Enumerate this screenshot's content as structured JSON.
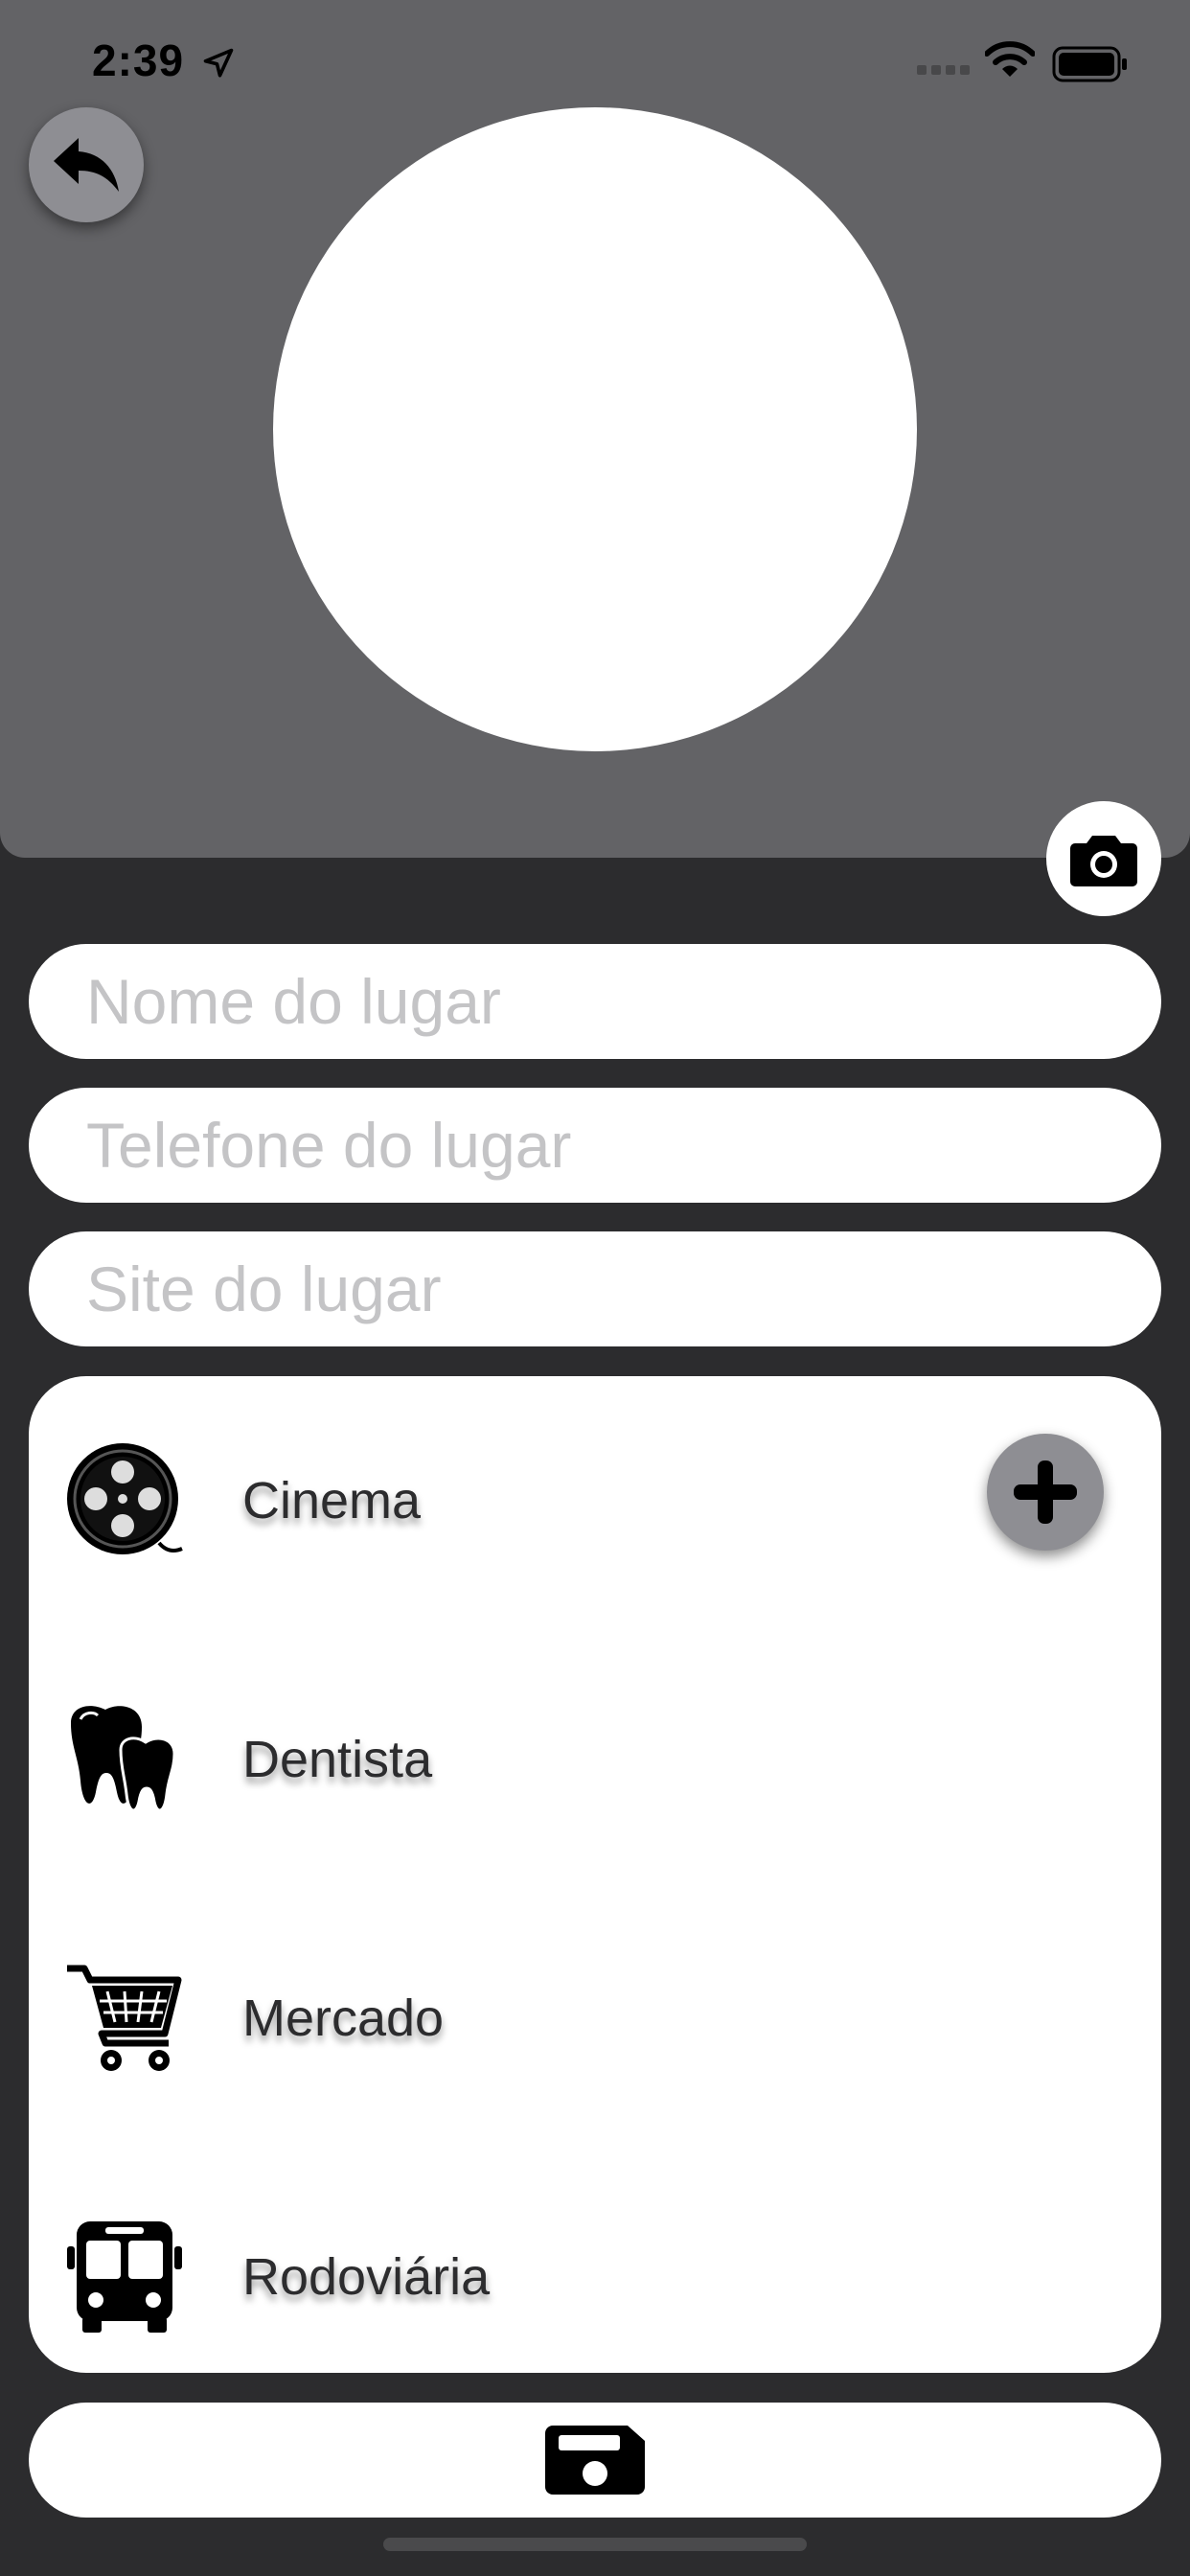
{
  "status_bar": {
    "time": "2:39",
    "icons": [
      "location-arrow-icon",
      "signal-icon",
      "wifi-icon",
      "battery-icon"
    ]
  },
  "header": {
    "back_icon": "reply-arrow-icon",
    "photo": "empty-photo-placeholder",
    "camera_icon": "camera-icon"
  },
  "form": {
    "name_placeholder": "Nome do lugar",
    "phone_placeholder": "Telefone do lugar",
    "site_placeholder": "Site do lugar",
    "name_value": "",
    "phone_value": "",
    "site_value": ""
  },
  "categories": {
    "add_icon": "plus-icon",
    "items": [
      {
        "label": "Cinema",
        "icon": "film-reel-icon"
      },
      {
        "label": "Dentista",
        "icon": "tooth-icon"
      },
      {
        "label": "Mercado",
        "icon": "shopping-cart-icon"
      },
      {
        "label": "Rodoviária",
        "icon": "bus-icon"
      }
    ]
  },
  "footer": {
    "save_icon": "floppy-disk-icon"
  },
  "colors": {
    "header_bg": "#636366",
    "page_bg": "#2c2c2e",
    "button_gray": "#8e8e93",
    "white": "#ffffff"
  }
}
